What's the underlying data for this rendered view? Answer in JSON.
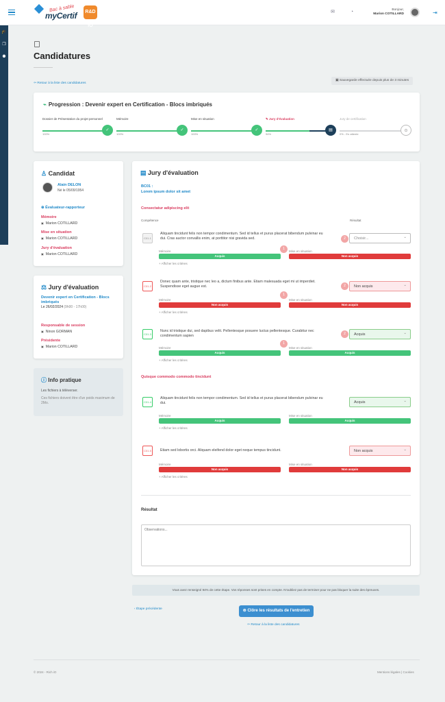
{
  "header": {
    "logo_text": "myCertif",
    "logo_sub": "Bac à sable",
    "logo_badge": "R&D iO",
    "greeting": "Bonjour,",
    "user_name": "Marion COTILLARD"
  },
  "page": {
    "title": "Candidatures",
    "back_link": "Retour à la liste des candidatures",
    "save_note": "Sauvegarde effectuée depuis plus de 3 minutes"
  },
  "progress": {
    "title": "Progression : Devenir expert en Certification - Blocs imbriqués",
    "steps": [
      {
        "label": "Dossier de Présentation du projet personnel",
        "pct": "100%",
        "state": "done"
      },
      {
        "label": "Mémoire",
        "pct": "100%",
        "state": "done"
      },
      {
        "label": "Mise en situation",
        "pct": "100%",
        "state": "done"
      },
      {
        "label": "Jury d'évaluation",
        "pct": "94%",
        "state": "current"
      },
      {
        "label": "Jury de certification",
        "pct": "0% - En attente",
        "state": "pending"
      }
    ]
  },
  "candidate": {
    "heading": "Candidat",
    "name": "Alain DELON",
    "born": "Né le 05/09/1954",
    "evaluator_heading": "Évaluateur-rapporteur",
    "memoire_label": "Mémoire",
    "memoire_person": "Marion COTILLARD",
    "mise_label": "Mise en situation",
    "mise_person": "Marion COTILLARD",
    "jury_label": "Jury d'évaluation",
    "jury_person": "Marion COTILLARD"
  },
  "jury_card": {
    "heading": "Jury d'évaluation",
    "course": "Devenir expert en Certification - Blocs imbriqués",
    "date": "Le 26/02/2024",
    "time": "(9h00 - 17h00)",
    "session_label": "Responsable de session",
    "session_person": "Ninon GORMAN",
    "president_label": "Présidente",
    "president_person": "Marion COTILLARD"
  },
  "info": {
    "heading": "Info pratique",
    "line1": "Les fichiers à téléverser.",
    "line2": "Ces fichiers doivent être d'un poids maximum de 2Mo."
  },
  "evaluation": {
    "heading": "Jury d'évaluation",
    "block_code": "BC01 :",
    "block_title": "Lorem ipsum dolor sit amet",
    "group1": "Consectatur adipiscing elit",
    "group2": "Quisque commodo commodo tincidunt",
    "col_competence": "Compétence",
    "col_resultat": "Résultat",
    "memoire": "Mémoire",
    "mise": "Mise en situation",
    "show_criteria": "+ Afficher les critères",
    "rows": [
      {
        "code": "C01.1",
        "text": "Aliquam tincidunt felis non tempor condimentum. Sed id tellus et purus placerat bibendum pulvinar eu dui. Cras auctor convallis enim, at porttitor nisi gravida sed.",
        "select": "Choisir...",
        "memoire": "Acquis",
        "mise": "Non acquis",
        "n1": "1",
        "n2": "2"
      },
      {
        "code": "C01.2",
        "text": "Donec quam ante, tristique nec leo a, dictum finibus ante. Etiam malesuada eget mi ut imperdiet. Suspendisse eget augue est.",
        "select": "Non acquis",
        "memoire": "Non acquis",
        "mise": "Non acquis",
        "n1": "1",
        "n2": "2"
      },
      {
        "code": "C01.3",
        "text": "Nunc id tristique dui, sed dapibus velit. Pellentesque posuere luctus pellentesque. Curabitur nec condimentum sapien",
        "select": "Acquis",
        "memoire": "Acquis",
        "mise": "Acquis",
        "n1": "1",
        "n2": "2"
      },
      {
        "code": "C01.4",
        "text": "Aliquam tincidunt felis non tempor condimentum. Sed id tellus et purus placerat bibendum pulvinar eu dui.",
        "select": "Acquis",
        "memoire": "Acquis",
        "mise": "Acquis"
      },
      {
        "code": "C01.5",
        "text": "Etiam sed lobortis orci. Aliquam eleifend dolor eget neque tempus tincidunt.",
        "select": "Non acquis",
        "memoire": "Non acquis",
        "mise": "Non acquis"
      }
    ],
    "result_label": "Résultat",
    "observations_placeholder": "Observations..."
  },
  "banner": "Vous avez renseigné 94% de cette étape. Vos réponses sont prises en compte. N'oubliez pas de terminer pour ne pas bloquer la suite des épreuves.",
  "actions": {
    "prev": "Étape précédente",
    "close": "Clôre les résultats de l'entretien",
    "back": "Retour à la liste des candidatures"
  },
  "footer": {
    "copy": "© 2024 - Rich iO",
    "legal": "Mentions légales",
    "cookies": "Cookies"
  }
}
